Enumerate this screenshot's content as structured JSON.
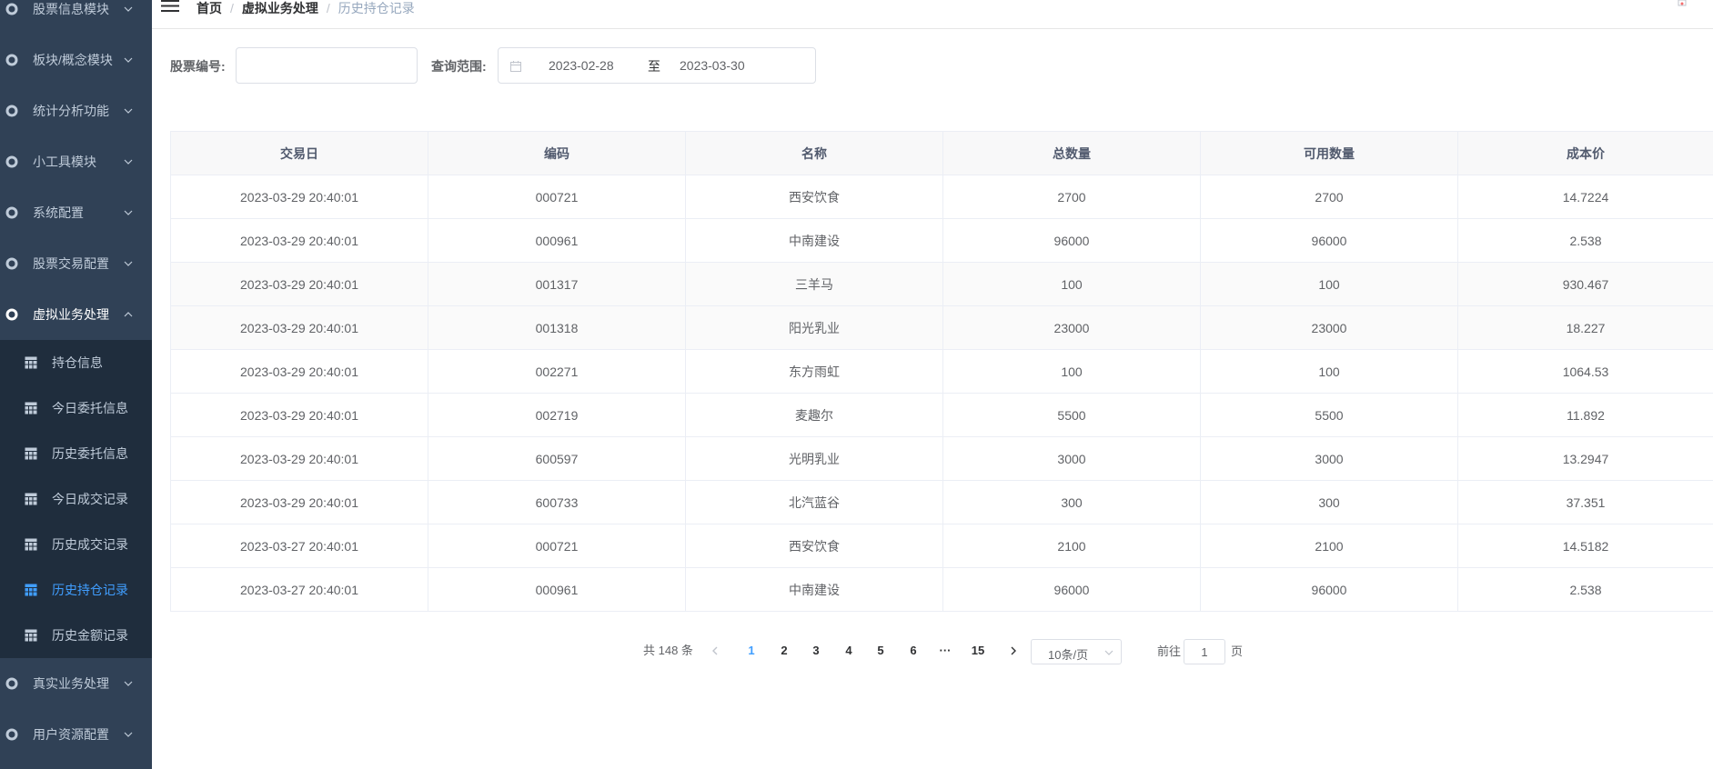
{
  "sidebar": {
    "menus": [
      {
        "label": "股票信息模块",
        "expanded": false
      },
      {
        "label": "板块/概念模块",
        "expanded": false
      },
      {
        "label": "统计分析功能",
        "expanded": false
      },
      {
        "label": "小工具模块",
        "expanded": false
      },
      {
        "label": "系统配置",
        "expanded": false
      },
      {
        "label": "股票交易配置",
        "expanded": false
      },
      {
        "label": "虚拟业务处理",
        "expanded": true
      },
      {
        "label": "真实业务处理",
        "expanded": false
      },
      {
        "label": "用户资源配置",
        "expanded": false
      }
    ],
    "submenu": [
      {
        "label": "持仓信息"
      },
      {
        "label": "今日委托信息"
      },
      {
        "label": "历史委托信息"
      },
      {
        "label": "今日成交记录"
      },
      {
        "label": "历史成交记录"
      },
      {
        "label": "历史持仓记录",
        "active": true
      },
      {
        "label": "历史金额记录"
      }
    ]
  },
  "breadcrumb": {
    "home": "首页",
    "section": "虚拟业务处理",
    "current": "历史持仓记录",
    "separator": "/"
  },
  "search": {
    "stock_label": "股票编号:",
    "stock_value": "",
    "range_label": "查询范围:",
    "start_date": "2023-02-28",
    "range_separator": "至",
    "end_date": "2023-03-30"
  },
  "table": {
    "columns": [
      "交易日",
      "编码",
      "名称",
      "总数量",
      "可用数量",
      "成本价"
    ],
    "rows": [
      [
        "2023-03-29 20:40:01",
        "000721",
        "西安饮食",
        "2700",
        "2700",
        "14.7224"
      ],
      [
        "2023-03-29 20:40:01",
        "000961",
        "中南建设",
        "96000",
        "96000",
        "2.538"
      ],
      [
        "2023-03-29 20:40:01",
        "001317",
        "三羊马",
        "100",
        "100",
        "930.467"
      ],
      [
        "2023-03-29 20:40:01",
        "001318",
        "阳光乳业",
        "23000",
        "23000",
        "18.227"
      ],
      [
        "2023-03-29 20:40:01",
        "002271",
        "东方雨虹",
        "100",
        "100",
        "1064.53"
      ],
      [
        "2023-03-29 20:40:01",
        "002719",
        "麦趣尔",
        "5500",
        "5500",
        "11.892"
      ],
      [
        "2023-03-29 20:40:01",
        "600597",
        "光明乳业",
        "3000",
        "3000",
        "13.2947"
      ],
      [
        "2023-03-29 20:40:01",
        "600733",
        "北汽蓝谷",
        "300",
        "300",
        "37.351"
      ],
      [
        "2023-03-27 20:40:01",
        "000721",
        "西安饮食",
        "2100",
        "2100",
        "14.5182"
      ],
      [
        "2023-03-27 20:40:01",
        "000961",
        "中南建设",
        "96000",
        "96000",
        "2.538"
      ]
    ]
  },
  "pagination": {
    "total_text": "共 148 条",
    "pages": [
      "1",
      "2",
      "3",
      "4",
      "5",
      "6"
    ],
    "ellipsis": "···",
    "last_page": "15",
    "current_page": "1",
    "page_size": "10条/页",
    "goto_label": "前往",
    "goto_value": "1",
    "goto_suffix": "页"
  },
  "colors": {
    "sidebar_bg": "#304156",
    "submenu_bg": "#1f2d3d",
    "accent": "#409eff",
    "menu_text": "#bfcbd9"
  }
}
